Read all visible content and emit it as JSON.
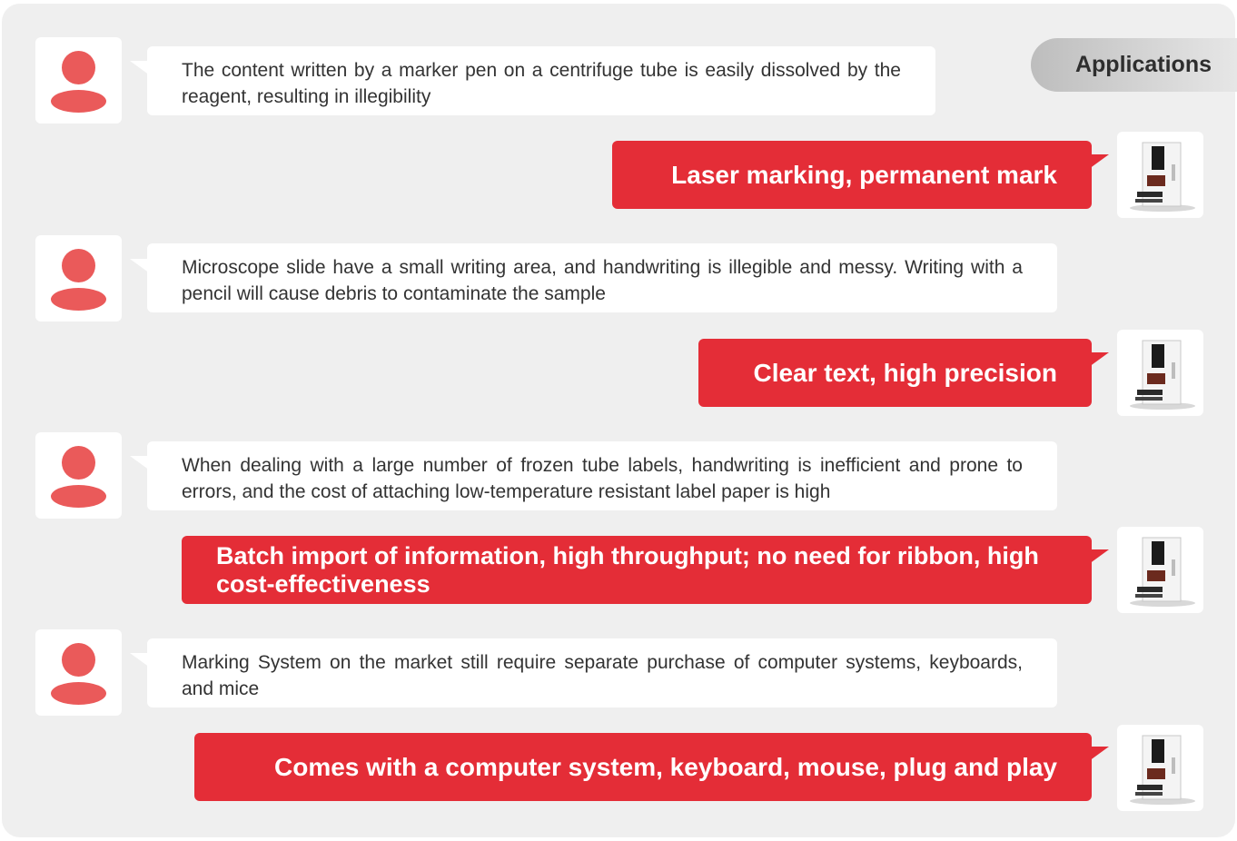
{
  "tab": {
    "label": "Applications"
  },
  "items": [
    {
      "question": "The content written by a marker pen on a centrifuge tube is easily dissolved by the reagent, resulting in illegibility",
      "answer": "Laser marking, permanent mark"
    },
    {
      "question": "Microscope slide have a small writing area, and handwriting is illegible and messy. Writing with a pencil will cause debris to contaminate the sample",
      "answer": "Clear text, high precision"
    },
    {
      "question": "When dealing with a large number of frozen tube labels, handwriting is inefficient and prone to errors, and the cost of attaching low-temperature resistant label paper is high",
      "answer": "Batch import of information, high throughput; no need for ribbon, high cost-effectiveness"
    },
    {
      "question": "Marking System on the market still require separate purchase of computer systems, keyboards, and mice",
      "answer": "Comes with a computer system, keyboard, mouse, plug and play"
    }
  ],
  "icons": {
    "user": "user-avatar-icon",
    "device": "laser-marking-machine-icon"
  },
  "colors": {
    "accent": "#e42d37",
    "avatar": "#ea5a5a",
    "panel": "#efefef"
  }
}
